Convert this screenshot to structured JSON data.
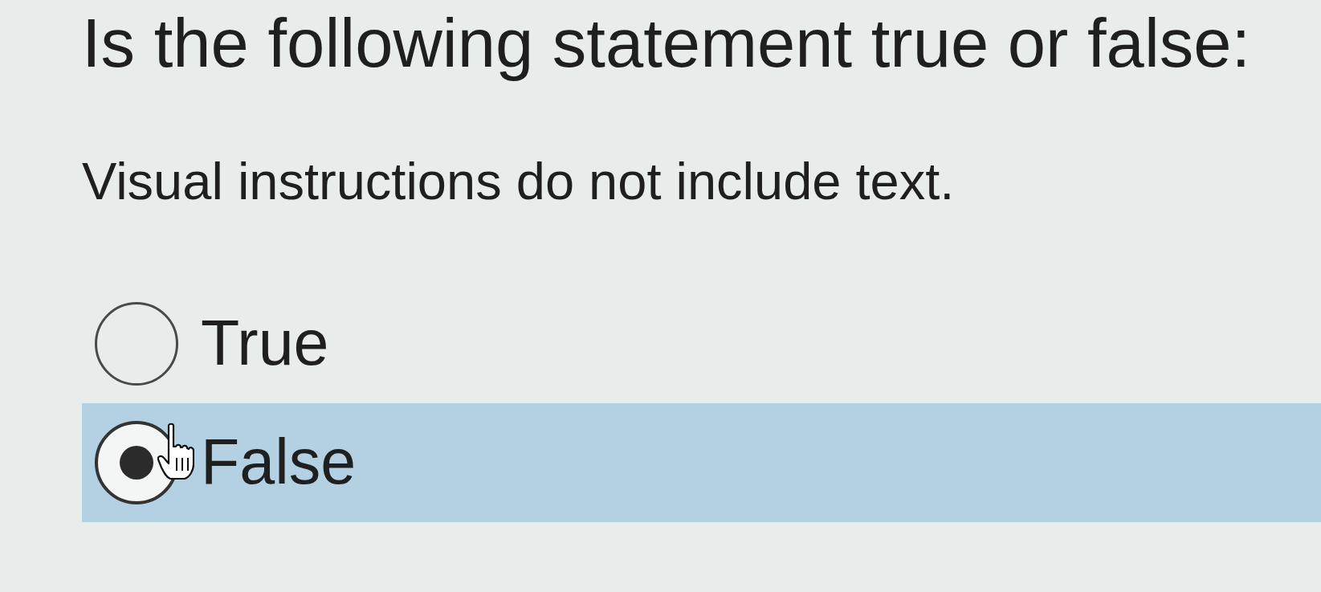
{
  "question": {
    "prompt": "Is the following statement true or false:",
    "statement": "Visual instructions do not include text."
  },
  "options": [
    {
      "label": "True",
      "selected": false
    },
    {
      "label": "False",
      "selected": true
    }
  ]
}
